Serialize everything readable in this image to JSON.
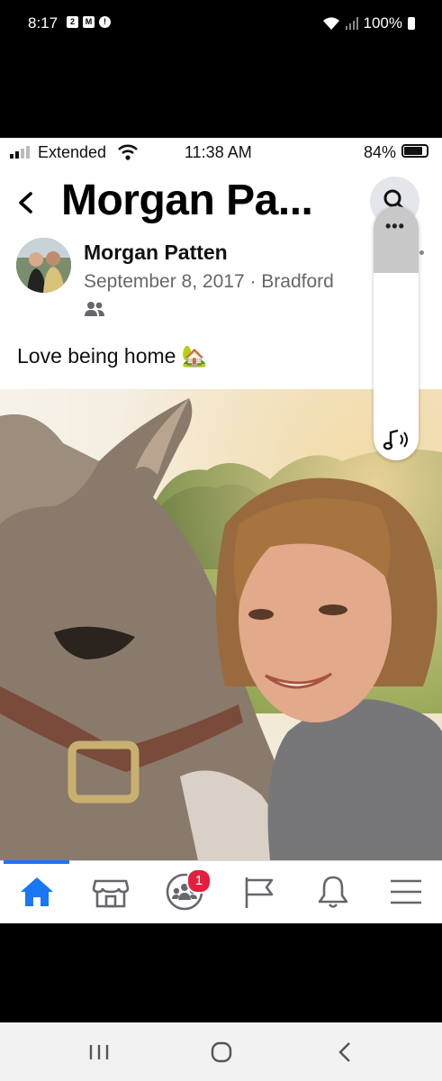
{
  "outer_status": {
    "time": "8:17",
    "notifications": [
      "2",
      "M",
      "!"
    ],
    "battery": "100%"
  },
  "inner_status": {
    "carrier": "Extended",
    "time": "11:38 AM",
    "battery": "84%",
    "battery_level": 0.84
  },
  "header": {
    "title": "Morgan Pa...",
    "back_icon": "chevron-left-icon",
    "search_icon": "search-icon"
  },
  "floating_panel": {
    "menu_icon": "more-horizontal-icon",
    "music_icon": "music-sound-icon"
  },
  "post": {
    "author": "Morgan Patten",
    "meta": "September 8, 2017 · Bradford",
    "audience_icon": "friends-icon",
    "caption": "Love being home 🏡"
  },
  "tabbar": {
    "tabs": [
      {
        "name": "home",
        "icon": "home-icon",
        "active": true
      },
      {
        "name": "marketplace",
        "icon": "marketplace-icon"
      },
      {
        "name": "groups",
        "icon": "groups-icon",
        "badge": "1"
      },
      {
        "name": "pages",
        "icon": "flag-icon"
      },
      {
        "name": "notifications",
        "icon": "bell-icon"
      },
      {
        "name": "menu",
        "icon": "hamburger-menu-icon"
      }
    ],
    "active_color": "#1877f2",
    "badge_color": "#e41e3f"
  },
  "system_nav": {
    "buttons": [
      "recent-apps-icon",
      "home-circle-icon",
      "back-arrow-icon"
    ]
  }
}
